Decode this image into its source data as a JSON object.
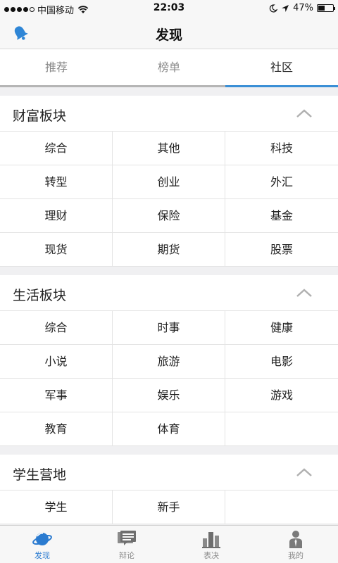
{
  "status": {
    "carrier": "中国移动",
    "time": "22:03",
    "battery": "47%",
    "battery_level": 0.47
  },
  "nav": {
    "title": "发现"
  },
  "top_tabs": [
    "推荐",
    "榜单",
    "社区"
  ],
  "sections": [
    {
      "title": "财富板块",
      "items": [
        "综合",
        "其他",
        "科技",
        "转型",
        "创业",
        "外汇",
        "理财",
        "保险",
        "基金",
        "现货",
        "期货",
        "股票"
      ]
    },
    {
      "title": "生活板块",
      "items": [
        "综合",
        "时事",
        "健康",
        "小说",
        "旅游",
        "电影",
        "军事",
        "娱乐",
        "游戏",
        "教育",
        "体育",
        ""
      ]
    },
    {
      "title": "学生营地",
      "items": [
        "学生",
        "新手",
        ""
      ]
    }
  ],
  "tab_bar": [
    {
      "label": "发现",
      "icon": "planet-icon"
    },
    {
      "label": "辩论",
      "icon": "chat-icon"
    },
    {
      "label": "表决",
      "icon": "bar-chart-icon"
    },
    {
      "label": "我的",
      "icon": "person-icon"
    }
  ],
  "colors": {
    "accent": "#3a8fd6",
    "active_tab_label": "#2b7bd0"
  }
}
